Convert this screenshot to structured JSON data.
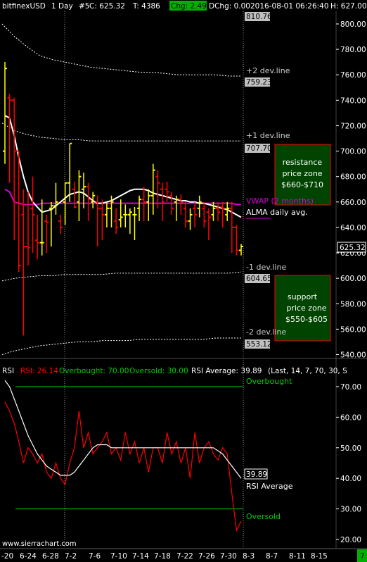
{
  "header": {
    "symbol": "bitfinexUSD",
    "period": "1 Day",
    "chart_num": "#5",
    "close": "C: 625.32",
    "ticks": "T: 4386",
    "change": "Chg: 2.49",
    "dchange": "DChg: 0.00",
    "datetime": "2016-08-01 06:26:40",
    "high": "H: 627.00"
  },
  "colors": {
    "background": "#000000",
    "up_bar": "#ffff00",
    "down_bar": "#ff0000",
    "vwap": "#d400d4",
    "alma": "#ffffff",
    "band": "#ffffff",
    "zone_fill": "#004400",
    "zone_border": "#ff0000",
    "rsi_line": "#ff0000",
    "rsi_avg": "#ffffff",
    "levels": "#00cc00",
    "chg_bg": "#00b000",
    "price_label_bg": "#c0c0c0"
  },
  "price_axis": {
    "ticks": [
      "800.00",
      "780.00",
      "760.00",
      "740.00",
      "720.00",
      "700.00",
      "680.00",
      "660.00",
      "640.00",
      "620.00",
      "600.00",
      "580.00",
      "560.00",
      "540.00"
    ]
  },
  "rsi_axis": {
    "ticks": [
      "70.00",
      "60.00",
      "50.00",
      "40.00",
      "30.00",
      "20.00"
    ]
  },
  "x_axis": {
    "labels": [
      "-20",
      "6-24",
      "6-28",
      "7-2",
      "7-6",
      "7-10",
      "7-14",
      "7-18",
      "7-22",
      "7-26",
      "7-30",
      "8-3",
      "8-7",
      "8-11",
      "8-15"
    ],
    "last_tab": "7"
  },
  "annotations": {
    "dev_plus2_text": "+2 dev.line",
    "dev_plus2_value": "759.23",
    "dev_plus1_text": "+1 dev.line",
    "dev_plus1_value": "707.70",
    "dev_minus1_text": "-1 dev.line",
    "dev_minus1_value": "604.65",
    "dev_minus2_text": "-2 dev.line",
    "dev_minus2_value": "553.12",
    "top_value": "810.76",
    "vwap_text": "VWAP (2 months)",
    "alma_text": "ALMA daily avg.",
    "current_price": "625.32",
    "resistance_l1": "resistance",
    "resistance_l2": "price zone",
    "resistance_l3": "$660-$710",
    "support_l1": "support",
    "support_l2": "price zone",
    "support_l3": "$550-$605",
    "overbought_text": "Overbought",
    "oversold_text": "Oversold",
    "rsi_value": "39.89",
    "rsi_avg_text": "RSI Average"
  },
  "rsi_header": {
    "name": "RSI",
    "rsi": "RSI: 26.14",
    "overbought": "Overbought: 70.00",
    "oversold": "Oversold: 30.00",
    "average": "RSI Average: 39.89",
    "params": "(Last, 14, 7, 70, 30, S"
  },
  "watermark": "www.sierrachart.com",
  "chart_data": {
    "type": "ohlc",
    "price_ylim": [
      533,
      813
    ],
    "rsi_ylim": [
      18,
      76
    ],
    "candles": [
      {
        "o": 700,
        "h": 770,
        "l": 690,
        "c": 765
      },
      {
        "o": 742,
        "h": 745,
        "l": 675,
        "c": 740
      },
      {
        "o": 740,
        "h": 742,
        "l": 630,
        "c": 700
      },
      {
        "o": 700,
        "h": 700,
        "l": 605,
        "c": 610
      },
      {
        "o": 650,
        "h": 670,
        "l": 555,
        "c": 625
      },
      {
        "o": 625,
        "h": 668,
        "l": 610,
        "c": 624
      },
      {
        "o": 655,
        "h": 680,
        "l": 620,
        "c": 650
      },
      {
        "o": 630,
        "h": 650,
        "l": 615,
        "c": 628
      },
      {
        "o": 628,
        "h": 662,
        "l": 618,
        "c": 628
      },
      {
        "o": 645,
        "h": 650,
        "l": 620,
        "c": 644
      },
      {
        "o": 655,
        "h": 660,
        "l": 625,
        "c": 657
      },
      {
        "o": 657,
        "h": 675,
        "l": 650,
        "c": 660
      },
      {
        "o": 645,
        "h": 650,
        "l": 635,
        "c": 640
      },
      {
        "o": 660,
        "h": 675,
        "l": 642,
        "c": 675
      },
      {
        "o": 675,
        "h": 706,
        "l": 660,
        "c": 706
      },
      {
        "o": 670,
        "h": 676,
        "l": 655,
        "c": 656
      },
      {
        "o": 660,
        "h": 685,
        "l": 645,
        "c": 680
      },
      {
        "o": 670,
        "h": 683,
        "l": 655,
        "c": 672
      },
      {
        "o": 672,
        "h": 675,
        "l": 645,
        "c": 662
      },
      {
        "o": 660,
        "h": 668,
        "l": 655,
        "c": 665
      },
      {
        "o": 660,
        "h": 665,
        "l": 625,
        "c": 655
      },
      {
        "o": 655,
        "h": 662,
        "l": 630,
        "c": 650
      },
      {
        "o": 650,
        "h": 660,
        "l": 640,
        "c": 655
      },
      {
        "o": 655,
        "h": 665,
        "l": 640,
        "c": 660
      },
      {
        "o": 645,
        "h": 655,
        "l": 635,
        "c": 640
      },
      {
        "o": 646,
        "h": 662,
        "l": 640,
        "c": 648
      },
      {
        "o": 650,
        "h": 658,
        "l": 640,
        "c": 650
      },
      {
        "o": 650,
        "h": 655,
        "l": 635,
        "c": 652
      },
      {
        "o": 650,
        "h": 656,
        "l": 630,
        "c": 650
      },
      {
        "o": 655,
        "h": 665,
        "l": 645,
        "c": 662
      },
      {
        "o": 662,
        "h": 672,
        "l": 645,
        "c": 660
      },
      {
        "o": 660,
        "h": 670,
        "l": 645,
        "c": 665
      },
      {
        "o": 665,
        "h": 690,
        "l": 650,
        "c": 685
      },
      {
        "o": 680,
        "h": 685,
        "l": 655,
        "c": 675
      },
      {
        "o": 670,
        "h": 675,
        "l": 645,
        "c": 660
      },
      {
        "o": 670,
        "h": 676,
        "l": 660,
        "c": 668
      },
      {
        "o": 665,
        "h": 668,
        "l": 650,
        "c": 655
      },
      {
        "o": 660,
        "h": 665,
        "l": 645,
        "c": 662
      },
      {
        "o": 662,
        "h": 666,
        "l": 650,
        "c": 660
      },
      {
        "o": 655,
        "h": 660,
        "l": 640,
        "c": 645
      },
      {
        "o": 645,
        "h": 655,
        "l": 638,
        "c": 650
      },
      {
        "o": 655,
        "h": 660,
        "l": 640,
        "c": 650
      },
      {
        "o": 655,
        "h": 665,
        "l": 648,
        "c": 660
      },
      {
        "o": 655,
        "h": 660,
        "l": 640,
        "c": 645
      },
      {
        "o": 652,
        "h": 655,
        "l": 630,
        "c": 648
      },
      {
        "o": 650,
        "h": 660,
        "l": 645,
        "c": 655
      },
      {
        "o": 655,
        "h": 660,
        "l": 645,
        "c": 652
      },
      {
        "o": 656,
        "h": 660,
        "l": 640,
        "c": 655
      },
      {
        "o": 650,
        "h": 660,
        "l": 645,
        "c": 655
      },
      {
        "o": 655,
        "h": 660,
        "l": 620,
        "c": 640
      },
      {
        "o": 640,
        "h": 642,
        "l": 618,
        "c": 622
      },
      {
        "o": 622,
        "h": 627,
        "l": 618,
        "c": 625
      }
    ],
    "alma": [
      728,
      726,
      712,
      695,
      680,
      668,
      660,
      656,
      652,
      653,
      654,
      657,
      660,
      663,
      666,
      667,
      668,
      667,
      664,
      661,
      659,
      659,
      660,
      661,
      663,
      665,
      667,
      669,
      670,
      670,
      670,
      669,
      667,
      666,
      665,
      664,
      663,
      662,
      661,
      661,
      660,
      660,
      659,
      659,
      658,
      657,
      656,
      655,
      654,
      652,
      650,
      648
    ],
    "vwap": [
      670,
      668,
      660,
      659,
      658,
      658,
      658,
      658,
      659,
      659,
      659,
      659,
      659,
      659,
      659,
      659,
      659,
      659,
      659,
      659,
      659,
      659,
      659,
      659,
      659,
      659,
      659,
      659,
      659,
      659,
      659,
      659,
      659,
      659,
      659,
      659,
      659,
      659,
      659,
      659,
      659,
      659,
      659,
      659,
      659,
      659,
      659,
      659,
      659,
      659,
      658,
      658
    ],
    "bands": {
      "plus2": [
        800,
        790,
        782,
        775,
        772,
        770,
        768,
        766,
        765,
        764,
        763,
        762,
        762,
        761,
        760,
        760,
        760,
        760,
        759,
        759
      ],
      "plus1": [
        722,
        716,
        713,
        711,
        710,
        709,
        709,
        708,
        708,
        708,
        708,
        708,
        708,
        708,
        708,
        708,
        708,
        708,
        708,
        708
      ],
      "minus1": [
        598,
        600,
        601,
        602,
        602,
        603,
        603,
        603,
        603,
        604,
        604,
        604,
        604,
        604,
        604,
        604,
        604,
        604,
        604,
        605
      ],
      "minus2": [
        540,
        543,
        545,
        547,
        548,
        549,
        550,
        550,
        551,
        551,
        551,
        552,
        552,
        552,
        552,
        552,
        552,
        553,
        553,
        553
      ]
    },
    "rsi": [
      65,
      62,
      58,
      52,
      45,
      50,
      48,
      45,
      48,
      42,
      40,
      45,
      40,
      38,
      45,
      50,
      62,
      50,
      55,
      48,
      50,
      52,
      55,
      48,
      50,
      46,
      55,
      48,
      52,
      45,
      50,
      42,
      50,
      50,
      45,
      55,
      48,
      52,
      45,
      50,
      40,
      55,
      45,
      50,
      52,
      48,
      46,
      50,
      48,
      35,
      23,
      26
    ],
    "rsi_avg": [
      72,
      70,
      66,
      62,
      58,
      54,
      51,
      48,
      46,
      44,
      43,
      42,
      41,
      41,
      41,
      42,
      44,
      46,
      48,
      50,
      51,
      51,
      51,
      50,
      50,
      50,
      50,
      50,
      50,
      50,
      50,
      50,
      50,
      50,
      50,
      50,
      50,
      50,
      50,
      50,
      50,
      50,
      50,
      50,
      50,
      50,
      49,
      48,
      46,
      44,
      42,
      40
    ],
    "overbought": 70,
    "oversold": 30
  }
}
